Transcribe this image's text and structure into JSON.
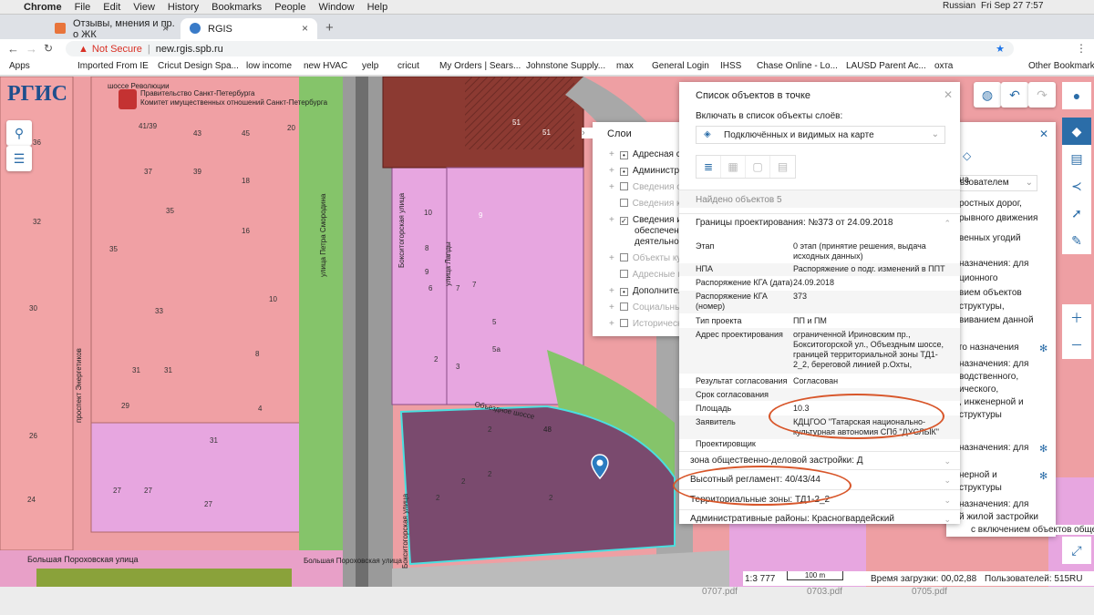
{
  "menubar": {
    "app": "Chrome",
    "items": [
      "File",
      "Edit",
      "View",
      "History",
      "Bookmarks",
      "People",
      "Window",
      "Help"
    ],
    "lang": "Russian",
    "datetime": "Fri Sep 27  7:57"
  },
  "tabs": [
    {
      "title": "Отзывы, мнения и пр. о ЖК"
    },
    {
      "title": "RGIS"
    }
  ],
  "url": {
    "warning": "Not Secure",
    "address": "new.rgis.spb.ru"
  },
  "bookmarks": [
    "Apps",
    "Imported From IE",
    "Cricut Design Spa...",
    "low income",
    "new HVAC",
    "yelp",
    "cricut",
    "My Orders | Sears...",
    "Johnstone Supply...",
    "max",
    "General Login",
    "IHSS",
    "Chase Online - Lo...",
    "LAUSD Parent Ac...",
    "охта",
    "Other Bookmarks"
  ],
  "logo": {
    "text": "РГИС",
    "org_line1": "Правительство Санкт-Петербурга",
    "org_line2": "Комитет имущественных отношений Санкт-Петербурга"
  },
  "layers": {
    "title": "Слои",
    "items": [
      {
        "label": "Адресная с",
        "checked": true,
        "expand": true
      },
      {
        "label": "Администра",
        "checked": true,
        "expand": true
      },
      {
        "label": "Сведения о",
        "checked": false,
        "expand": true
      },
      {
        "label": "Сведения к",
        "checked": false,
        "expand": false
      },
      {
        "label": "Сведения и",
        "checked": true,
        "expand": true
      },
      {
        "label": "обеспечени",
        "checked": null,
        "expand": false
      },
      {
        "label": "деятельност",
        "checked": null,
        "expand": false
      },
      {
        "label": "Объекты ку",
        "checked": false,
        "expand": true
      },
      {
        "label": "Адресные п",
        "checked": false,
        "expand": false
      },
      {
        "label": "Дополнител",
        "checked": true,
        "expand": true
      },
      {
        "label": "Социальны",
        "checked": false,
        "expand": true
      },
      {
        "label": "Историческ",
        "checked": false,
        "expand": true
      }
    ]
  },
  "popup": {
    "title": "Список объектов в точке",
    "include_label": "Включать в список объекты слоёв:",
    "dropdown": "Подключённых и видимых на карте",
    "found": "Найдено объектов 5",
    "section1": "Границы проектирования: №373 от 24.09.2018",
    "rows": [
      {
        "k": "Этап",
        "v": "0 этап (принятие решения, выдача исходных данных)"
      },
      {
        "k": "НПА",
        "v": "Распоряжение о подг. изменений в ППТ"
      },
      {
        "k": "Распоряжение КГА (дата)",
        "v": "24.09.2018"
      },
      {
        "k": "Распоряжение КГА (номер)",
        "v": "373"
      },
      {
        "k": "Тип проекта",
        "v": "ПП и ПМ"
      },
      {
        "k": "Адрес проектирования",
        "v": "ограниченной Ириновским пр., Бокситогорской ул., Объездным шоссе, границей территориальной зоны ТД1-2_2, береговой линией р.Охты,"
      },
      {
        "k": "Результат согласования",
        "v": "Согласован"
      },
      {
        "k": "Срок согласования",
        "v": ""
      },
      {
        "k": "Площадь",
        "v": "10.3"
      },
      {
        "k": "Заявитель",
        "v": "КДЦГОО \"Татарская национально-культурная автономия СПб \"ДУСЛЫК\""
      },
      {
        "k": "Проектировщик",
        "v": ""
      }
    ],
    "sections": [
      "зона общественно-деловой застройки: Д",
      "Высотный регламент: 40/43/44",
      "Территориальные зоны: ТД1-2_2",
      "Административные районы: Красногвардейский"
    ]
  },
  "right_panel": {
    "dropdown": "льзователем",
    "lines": [
      "на",
      "ростных дорог,",
      "рывного движения",
      "венных угодий",
      "назначения: для",
      "ционного",
      "вием объектов",
      "структуры,",
      "виванием данной",
      "го назначения",
      "назначения: для",
      "водственного,",
      "ического,",
      ", инженерной и",
      "структуры",
      "назначения: для",
      "нерной и",
      "структуры",
      "назначения: для",
      "й жилой застройки",
      "с включением объектов общественно-"
    ]
  },
  "status": {
    "scale": "1:3 777",
    "scalebar": "100 m",
    "load": "Время загрузки: 00,02,88",
    "users": "Пользователей: 515",
    "lang": "RU"
  },
  "map_labels": {
    "street1": "Большая Пороховская улица",
    "street2": "Большая Пороховская улица",
    "street3": "Бокситогорская улица",
    "street4": "проспект Энергетиков",
    "street5": "улица Петра Смородина",
    "street6": "улица Лапды",
    "street7": "шоссе Революции",
    "street8": "Объездное шоссе",
    "street9": "Бокситогорская улица"
  },
  "desktop_files": [
    "0707.pdf",
    "0703.pdf",
    "0705.pdf"
  ],
  "colors": {
    "zone_red": "#f0a0a4",
    "zone_pink": "#e7a6e0",
    "zone_brown": "#8c3a32",
    "zone_green": "#85c46a",
    "road": "#a8a8a8",
    "accent": "#2b6da8",
    "highlight": "#d8562a"
  }
}
